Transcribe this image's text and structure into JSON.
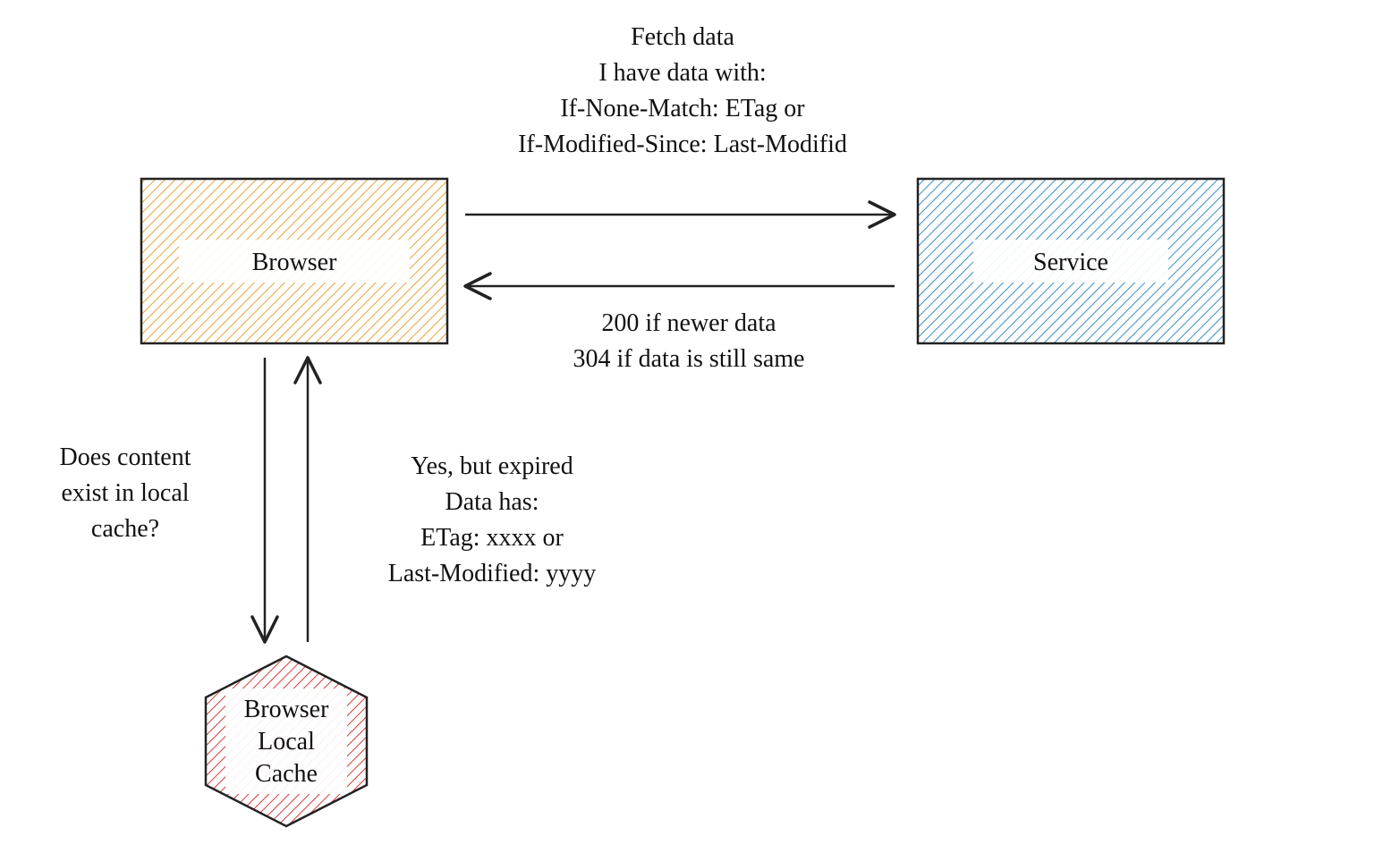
{
  "nodes": {
    "browser": {
      "label": "Browser"
    },
    "service": {
      "label": "Service"
    },
    "cache": {
      "line1": "Browser",
      "line2": "Local",
      "line3": "Cache"
    }
  },
  "request_top": {
    "line1": "Fetch data",
    "line2": "I have data with:",
    "line3": "If-None-Match: ETag or",
    "line4": "If-Modified-Since: Last-Modifid"
  },
  "response_bottom": {
    "line1": "200 if newer data",
    "line2": "304 if data is still same"
  },
  "cache_query": {
    "line1": "Does content",
    "line2": "exist in local",
    "line3": "cache?"
  },
  "cache_reply": {
    "line1": "Yes, but expired",
    "line2": "Data has:",
    "line3": "ETag: xxxx or",
    "line4": "Last-Modified: yyyy"
  },
  "colors": {
    "browser_fill": "#e8a33c",
    "service_fill": "#3b8ec2",
    "cache_fill": "#d23b3b",
    "stroke": "#222"
  }
}
